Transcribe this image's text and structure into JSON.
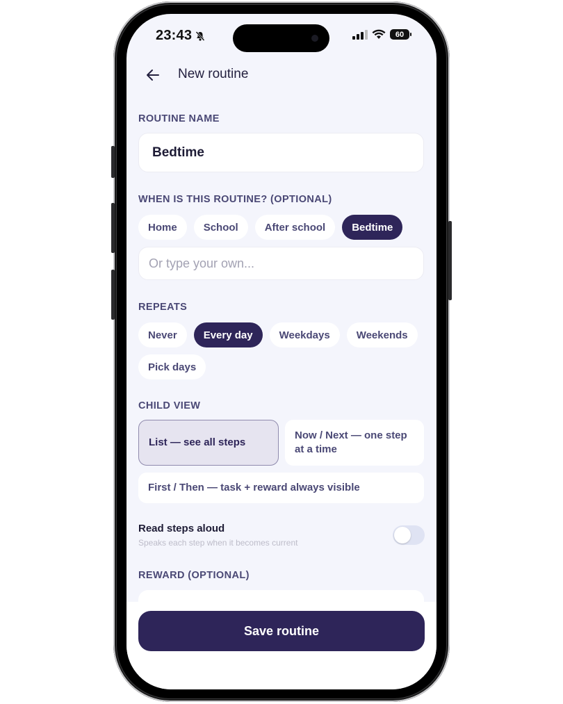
{
  "status_bar": {
    "time": "23:43",
    "battery": "60",
    "icons": [
      "bell-slash-icon",
      "signal-icon",
      "wifi-icon",
      "battery-icon"
    ]
  },
  "header": {
    "title": "New routine",
    "back_icon": "arrow-left-icon"
  },
  "routine_name": {
    "label": "ROUTINE NAME",
    "value": "Bedtime"
  },
  "when": {
    "label": "WHEN IS THIS ROUTINE? (OPTIONAL)",
    "chips": [
      "Home",
      "School",
      "After school",
      "Bedtime"
    ],
    "selected": "Bedtime",
    "custom_placeholder": "Or type your own..."
  },
  "repeats": {
    "label": "REPEATS",
    "chips": [
      "Never",
      "Every day",
      "Weekdays",
      "Weekends",
      "Pick days"
    ],
    "selected": "Every day"
  },
  "child_view": {
    "label": "CHILD VIEW",
    "options": [
      "List — see all steps",
      "Now / Next — one step at a time",
      "First / Then — task + reward always visible"
    ],
    "selected": "List — see all steps"
  },
  "read_aloud": {
    "title": "Read steps aloud",
    "subtitle": "Speaks each step when it becomes current",
    "enabled": false
  },
  "reward": {
    "label": "REWARD (OPTIONAL)"
  },
  "save_button": "Save routine",
  "colors": {
    "primary": "#2e2559",
    "background": "#f4f5fc",
    "label": "#4a4875"
  }
}
